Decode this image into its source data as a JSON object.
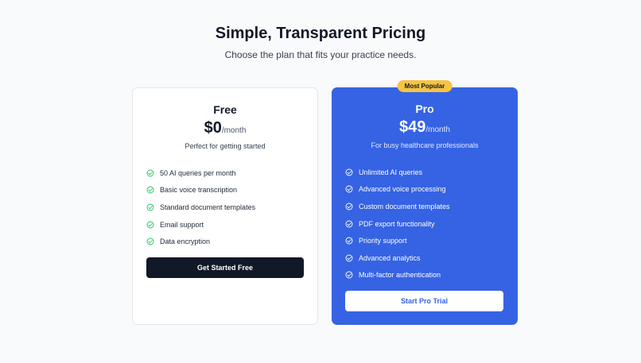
{
  "header": {
    "title": "Simple, Transparent Pricing",
    "subtitle": "Choose the plan that fits your practice needs."
  },
  "plans": [
    {
      "name": "Free",
      "price": "$0",
      "period": "/month",
      "tagline": "Perfect for getting started",
      "features": [
        "50 AI queries per month",
        "Basic voice transcription",
        "Standard document templates",
        "Email support",
        "Data encryption"
      ],
      "cta": "Get Started Free"
    },
    {
      "name": "Pro",
      "badge": "Most Popular",
      "price": "$49",
      "period": "/month",
      "tagline": "For busy healthcare professionals",
      "features": [
        "Unlimited AI queries",
        "Advanced voice processing",
        "Custom document templates",
        "PDF export functionality",
        "Priority support",
        "Advanced analytics",
        "Multi-factor authentication"
      ],
      "cta": "Start Pro Trial"
    }
  ],
  "colors": {
    "pro_card": "#3563e3",
    "badge": "#f6c343",
    "check_free": "#22c55e",
    "check_pro": "#ffffff",
    "free_cta": "#111827"
  },
  "icons": {
    "feature": "check-circle-icon"
  }
}
